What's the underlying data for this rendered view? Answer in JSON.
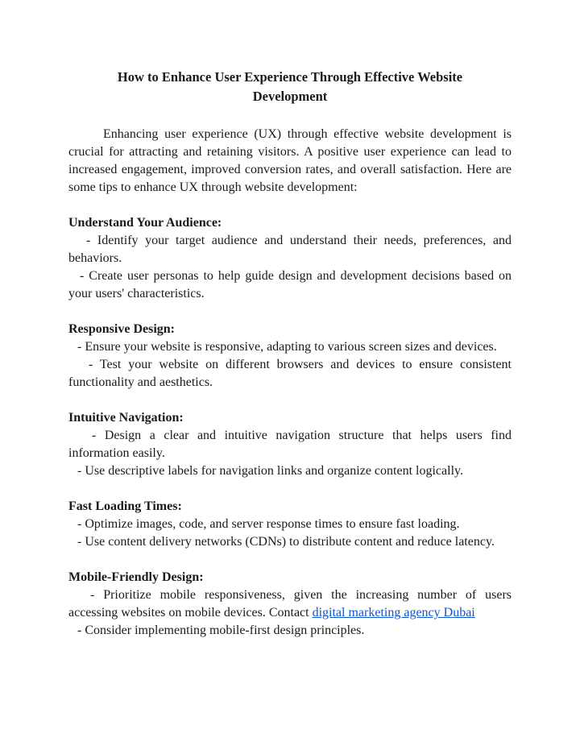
{
  "document": {
    "title_line1": "How to Enhance User Experience Through Effective Website",
    "title_line2": "Development",
    "intro": "Enhancing user experience (UX) through effective website development is crucial for attracting and retaining visitors. A positive user experience can lead to increased engagement, improved conversion rates, and overall satisfaction. Here are some tips to enhance UX through website development:",
    "sections": [
      {
        "heading": "Understand Your Audience:",
        "items": [
          "- Identify your target audience and understand their needs, preferences, and behaviors.",
          "- Create user personas to help guide design and development decisions based on your users' characteristics."
        ]
      },
      {
        "heading": "Responsive Design:",
        "items": [
          "- Ensure your website is responsive, adapting to various screen sizes and devices.",
          "- Test your website on different browsers and devices to ensure consistent functionality and aesthetics."
        ]
      },
      {
        "heading": "Intuitive Navigation:",
        "items": [
          "- Design a clear and intuitive navigation structure that helps users find information easily.",
          "- Use descriptive labels for navigation links and organize content logically."
        ]
      },
      {
        "heading": "Fast Loading Times:",
        "items": [
          "- Optimize images, code, and server response times to ensure fast loading.",
          "- Use content delivery networks (CDNs) to distribute content and reduce latency."
        ]
      },
      {
        "heading": "Mobile-Friendly Design:",
        "items": [
          "- Prioritize mobile responsiveness, given the increasing number of users accessing websites on mobile devices. Contact",
          "- Consider implementing mobile-first design principles."
        ],
        "link_text": "digital marketing agency Dubai"
      }
    ]
  },
  "colors": {
    "link": "#1155cc",
    "text": "#1a1a1a"
  }
}
